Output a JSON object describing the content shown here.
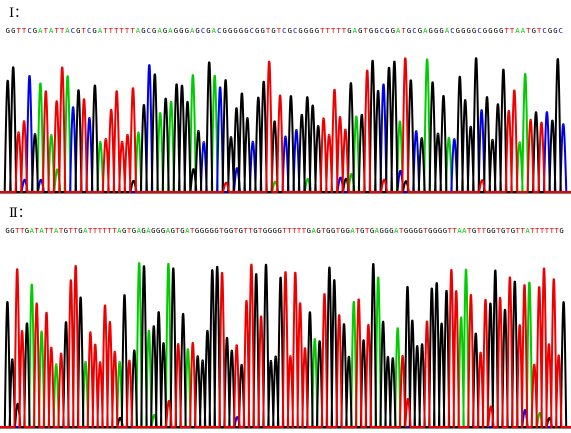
{
  "colors": {
    "A": "#00cc00",
    "C": "#0000ee",
    "G": "#000000",
    "T": "#ee0000"
  },
  "panels": [
    {
      "label": "Ⅰ：",
      "sequence": "GGTTCGATATTACGTCGATTTTTTAGCGAGAGGGAGCGACGGGGGCGGTGTCGCGGGGTTTTTGAGTGGCGGATGCGAGGGACGGGGCGGGGTTAATGTCGGC"
    },
    {
      "label": "Ⅱ：",
      "sequence": "GGTTGATATTATGTTGATTTTTTAGTGAGAGGGAGTGATGGGGGTGGTGTTGTGGGGTTTTTGAGTGGTGGATGTGAGGGATGGGGTGGGGTTAATGTTGGTGTGTTATTTTTTG"
    }
  ]
}
